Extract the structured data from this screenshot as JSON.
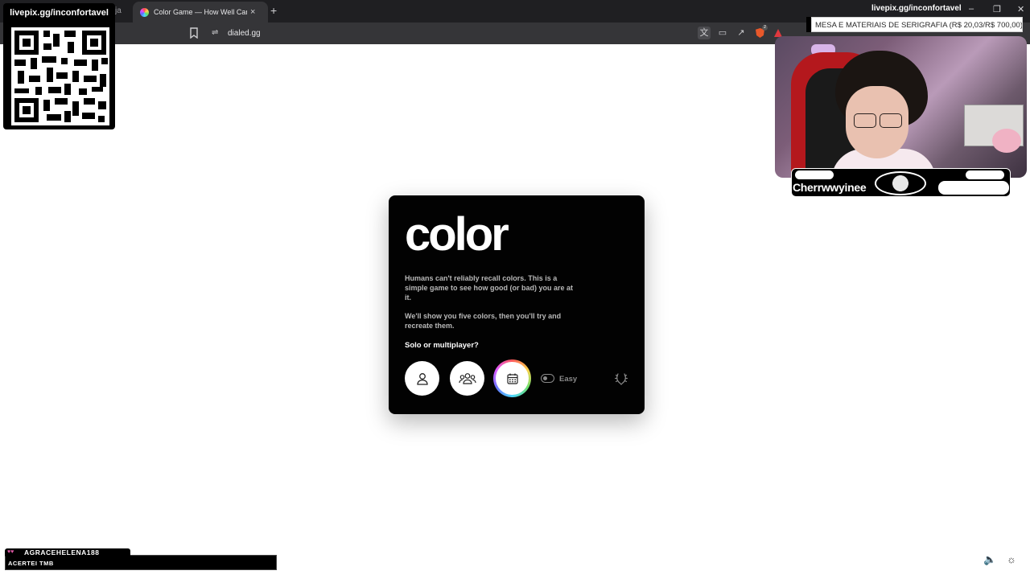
{
  "browser": {
    "prev_tab_fragment": "ja",
    "active_tab_title": "Color Game — How Well Can You See Color?",
    "tab_close": "×",
    "new_tab": "+",
    "url": "dialed.gg",
    "brave_badge": "2",
    "window_controls": [
      "–",
      "❐",
      "✕"
    ]
  },
  "overlays": {
    "qr_title": "livepix.gg/inconfortavel",
    "livepix_top": "livepix.gg/inconfortavel",
    "ticker": "MESA E MATERIAIS DE SERIGRAFIA (R$ 20,03/R$ 700,00)",
    "streamer_name": "Cherrwwyinee",
    "chat_user": "AGRACEHELENA188",
    "chat_message": "ACERTEI TMB"
  },
  "game": {
    "title": "color",
    "para1": "Humans can't reliably recall colors. This is a simple game to see how good (or bad) you are at it.",
    "para2": "We'll show you five colors, then you'll try and recreate them.",
    "question": "Solo or multiplayer?",
    "difficulty_label": "Easy",
    "difficulty_on": false,
    "modes": [
      "solo-icon",
      "multiplayer-icon",
      "calendar-icon"
    ]
  },
  "colors": {
    "card_bg": "#020202",
    "page_bg": "#ffffff",
    "tab_bar": "#1f1f22",
    "toolbar": "#353538"
  }
}
